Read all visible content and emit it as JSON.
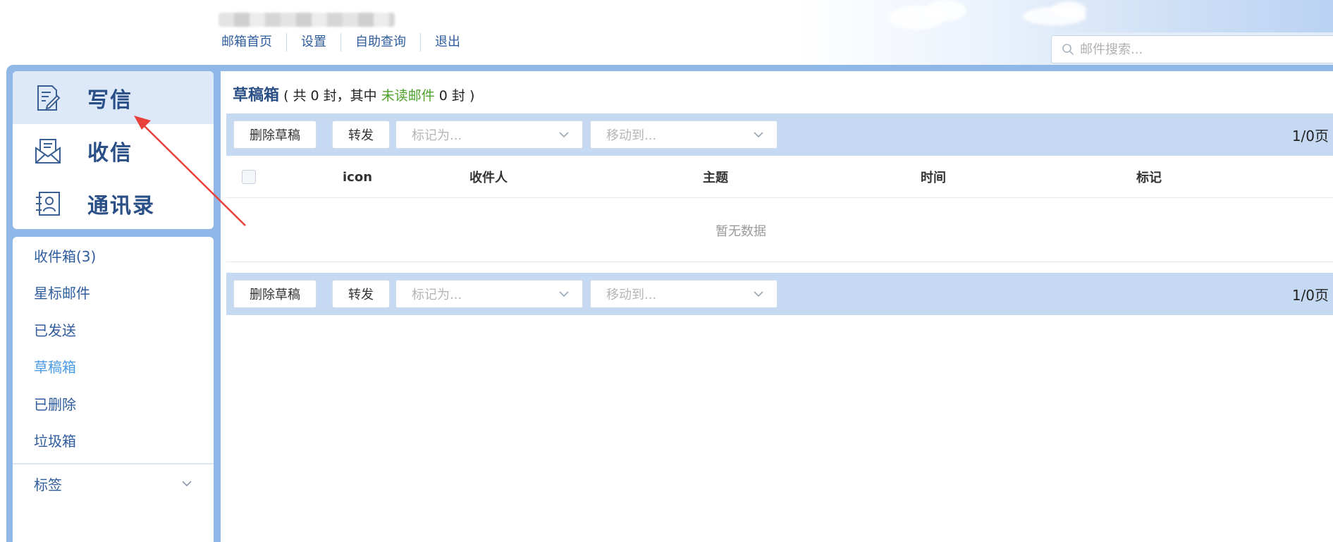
{
  "header": {
    "nav": [
      "邮箱首页",
      "设置",
      "自助查询",
      "退出"
    ],
    "search_placeholder": "邮件搜索..."
  },
  "sidebar": {
    "actions": [
      {
        "label": "写信",
        "icon": "compose-icon"
      },
      {
        "label": "收信",
        "icon": "inbox-envelope-icon"
      },
      {
        "label": "通讯录",
        "icon": "contacts-icon"
      }
    ],
    "folders": [
      "收件箱(3)",
      "星标邮件",
      "已发送",
      "草稿箱",
      "已删除",
      "垃圾箱"
    ],
    "current_folder": "草稿箱",
    "tags_label": "标签"
  },
  "main": {
    "title": "草稿箱",
    "summary_prefix": "( 共 0 封，其中 ",
    "unread_label": "未读邮件",
    "summary_suffix": " 0 封 )",
    "toolbar": {
      "delete_label": "删除草稿",
      "forward_label": "转发",
      "mark_placeholder": "标记为...",
      "move_placeholder": "移动到...",
      "pager": "1/0页"
    },
    "table": {
      "columns": [
        "icon",
        "收件人",
        "主题",
        "时间",
        "标记"
      ],
      "empty_text": "暂无数据"
    }
  },
  "colors": {
    "frame": "#8fb8e8",
    "toolbar": "#c5daf2",
    "link": "#2f5c9c",
    "active_folder": "#4a9be6",
    "unread": "#4ca12b",
    "annotation_arrow": "#e8403a"
  }
}
